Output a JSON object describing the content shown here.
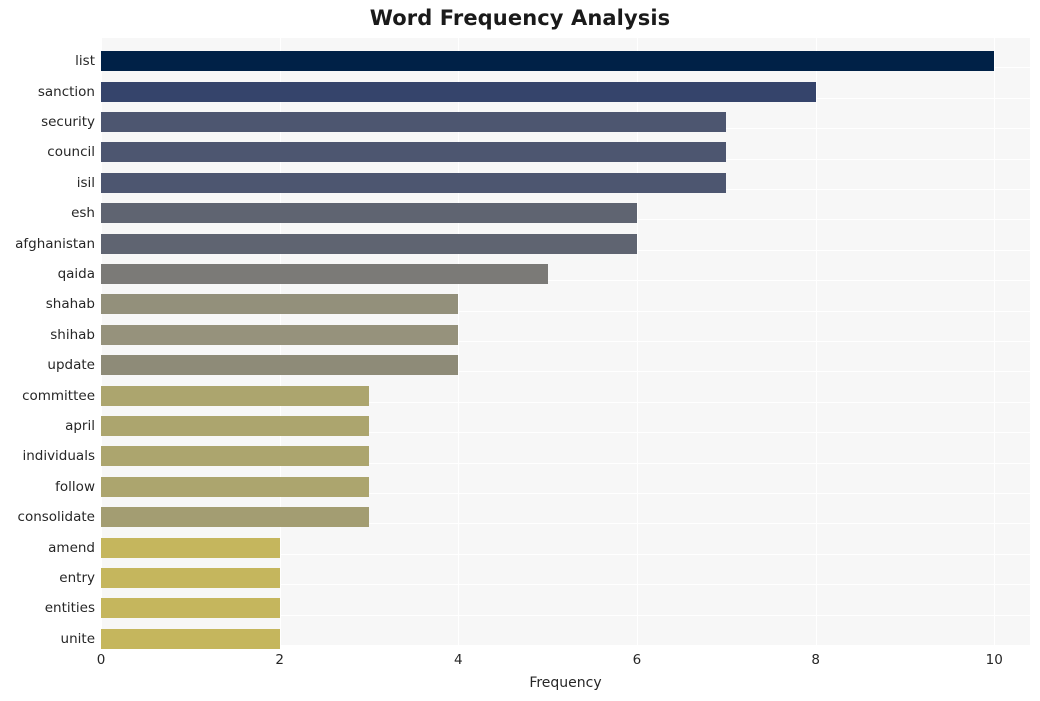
{
  "chart_data": {
    "type": "bar",
    "orientation": "horizontal",
    "title": "Word Frequency Analysis",
    "xlabel": "Frequency",
    "ylabel": "",
    "xlim": [
      0,
      10.4
    ],
    "ylim": null,
    "grid": true,
    "legend": null,
    "xticks": [
      "0",
      "2",
      "4",
      "6",
      "8",
      "10"
    ],
    "xtick_values": [
      0,
      2,
      4,
      6,
      8,
      10
    ],
    "categories": [
      "list",
      "sanction",
      "security",
      "council",
      "isil",
      "esh",
      "afghanistan",
      "qaida",
      "shahab",
      "shihab",
      "update",
      "committee",
      "april",
      "individuals",
      "follow",
      "consolidate",
      "amend",
      "entry",
      "entities",
      "unite"
    ],
    "values": [
      10,
      8,
      7,
      7,
      7,
      6,
      6,
      5,
      4,
      4,
      4,
      3,
      3,
      3,
      3,
      3,
      2,
      2,
      2,
      2
    ],
    "bar_colors": [
      "#002147",
      "#35446b",
      "#4d5670",
      "#4d5670",
      "#4d5670",
      "#5f6471",
      "#5f6471",
      "#7b7a77",
      "#93907b",
      "#96927c",
      "#8e8b78",
      "#aca56e",
      "#aca56e",
      "#aca56e",
      "#aca56e",
      "#a39d72",
      "#c5b65d",
      "#c5b65d",
      "#c5b65d",
      "#c5b65d"
    ],
    "plot_background": "#f7f7f7",
    "grid_color": "#ffffff",
    "text_color": "#262626"
  }
}
